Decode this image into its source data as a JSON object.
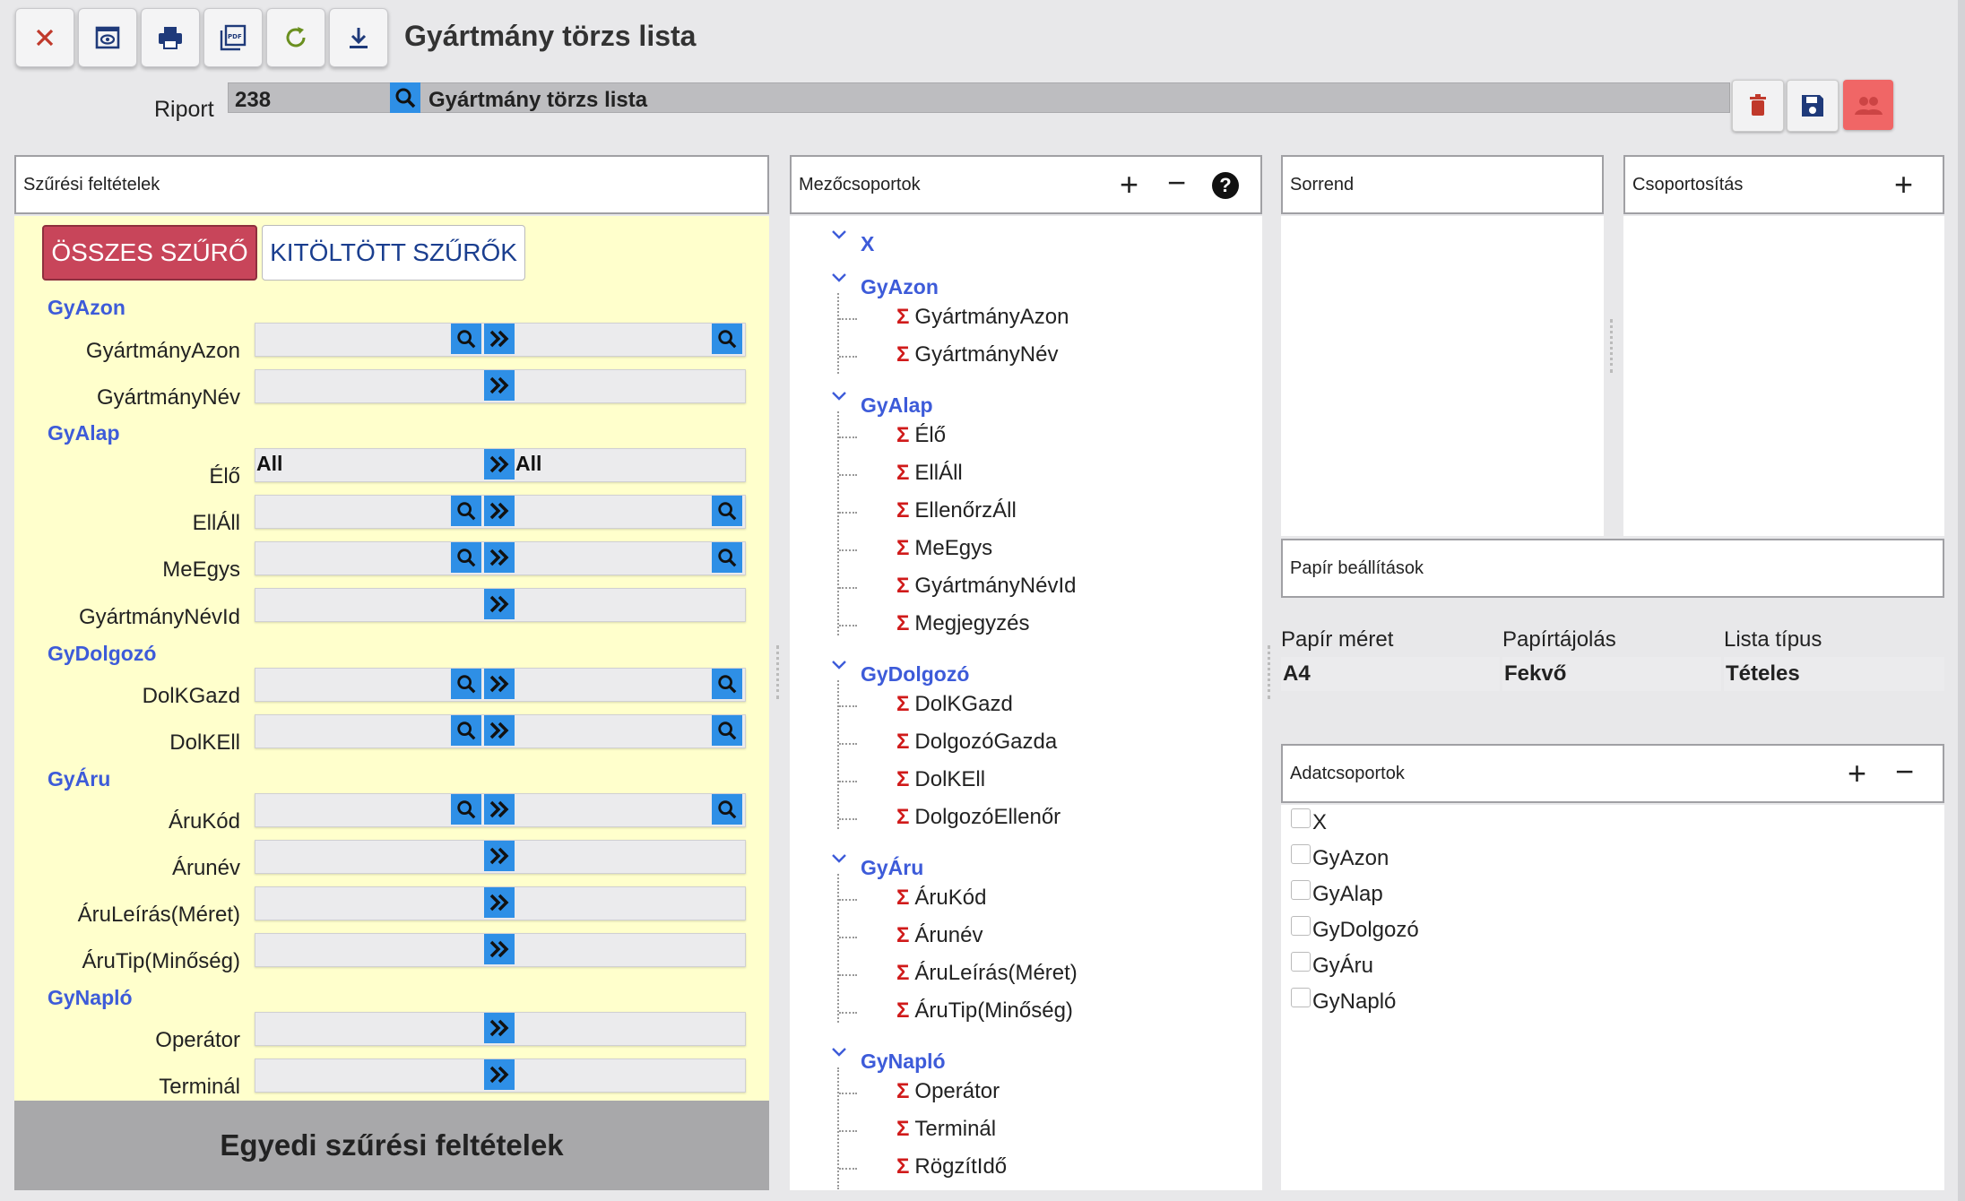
{
  "toolbar": {
    "title": "Gyártmány törzs lista",
    "buttons": [
      "close-icon",
      "preview-icon",
      "print-icon",
      "pdf-icon",
      "refresh-icon",
      "download-icon"
    ]
  },
  "riport": {
    "label": "Riport",
    "code": "238",
    "name": "Gyártmány törzs lista"
  },
  "filters": {
    "header": "Szűrési feltételek",
    "all_button": "ÖSSZES SZŰRŐ",
    "filled_button": "KITÖLTÖTT SZŰRŐK",
    "all_value": "All",
    "groups": [
      {
        "name": "GyAzon",
        "fields": [
          "GyártmányAzon",
          "GyártmányNév"
        ]
      },
      {
        "name": "GyAlap",
        "fields": [
          "Élő",
          "EllÁll",
          "MeEgys",
          "GyártmányNévId"
        ]
      },
      {
        "name": "GyDolgozó",
        "fields": [
          "DolKGazd",
          "DolKEll"
        ]
      },
      {
        "name": "GyÁru",
        "fields": [
          "ÁruKód",
          "Árunév",
          "ÁruLeírás(Méret)",
          "ÁruTip(Minőség)"
        ]
      },
      {
        "name": "GyNapló",
        "fields": [
          "Operátor",
          "Terminál"
        ]
      }
    ],
    "custom_footer": "Egyedi szűrési feltételek"
  },
  "fieldgroups": {
    "header": "Mezőcsoportok",
    "groups": [
      {
        "name": "X",
        "items": []
      },
      {
        "name": "GyAzon",
        "items": [
          "GyártmányAzon",
          "GyártmányNév"
        ]
      },
      {
        "name": "GyAlap",
        "items": [
          "Élő",
          "EllÁll",
          "EllenőrzÁll",
          "MeEgys",
          "GyártmányNévId",
          "Megjegyzés"
        ]
      },
      {
        "name": "GyDolgozó",
        "items": [
          "DolKGazd",
          "DolgozóGazda",
          "DolKEll",
          "DolgozóEllenőr"
        ]
      },
      {
        "name": "GyÁru",
        "items": [
          "ÁruKód",
          "Árunév",
          "ÁruLeírás(Méret)",
          "ÁruTip(Minőség)"
        ]
      },
      {
        "name": "GyNapló",
        "items": [
          "Operátor",
          "Terminál",
          "RögzítIdő"
        ]
      }
    ]
  },
  "sorrend": {
    "header": "Sorrend"
  },
  "grouping": {
    "header": "Csoportosítás"
  },
  "paper": {
    "header": "Papír beállítások",
    "size_label": "Papír méret",
    "orientation_label": "Papírtájolás",
    "list_type_label": "Lista típus",
    "size_value": "A4",
    "orientation_value": "Fekvő",
    "list_type_value": "Tételes"
  },
  "datagroups": {
    "header": "Adatcsoportok",
    "items": [
      "X",
      "GyAzon",
      "GyAlap",
      "GyDolgozó",
      "GyÁru",
      "GyNapló"
    ]
  },
  "colors": {
    "accent": "#2e8fe6",
    "group_label": "#3d5bd9",
    "filter_bg": "#ffffcc",
    "danger": "#c8455a"
  }
}
